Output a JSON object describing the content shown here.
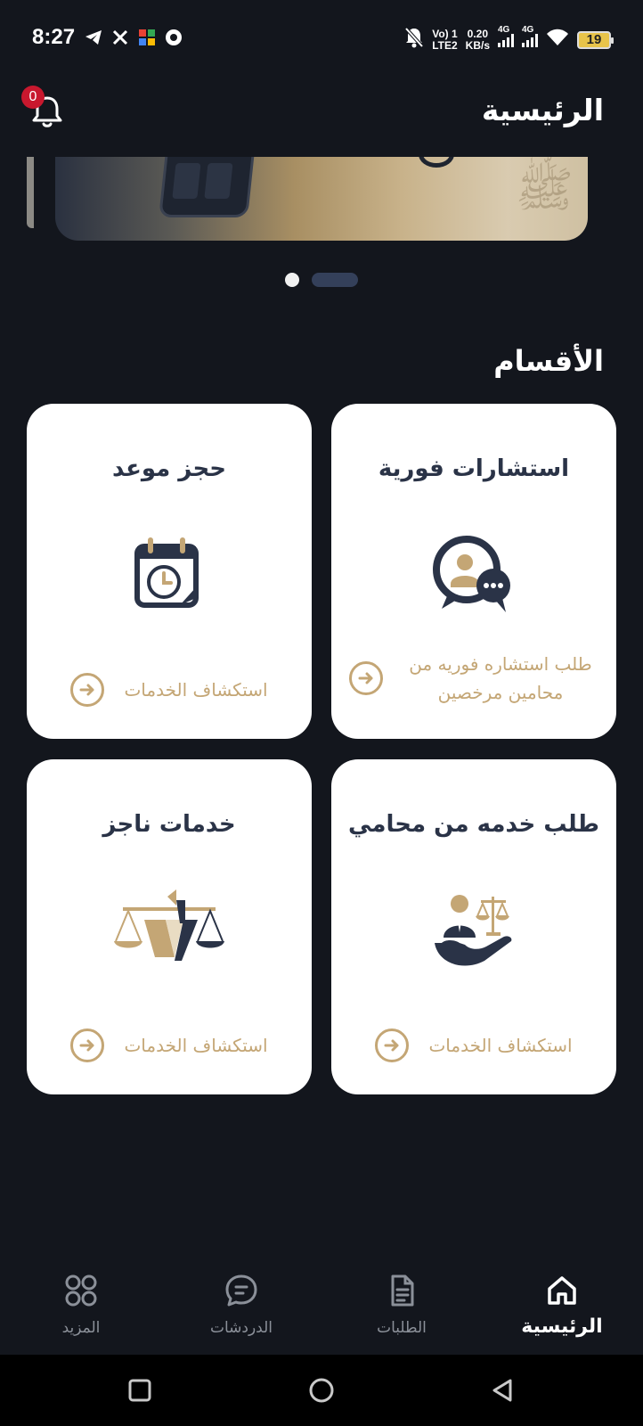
{
  "status_bar": {
    "time": "8:27",
    "network_line1": "Vo) 1",
    "network_line2": "LTE2",
    "speed_value": "0.20",
    "speed_unit": "KB/s",
    "sim1_label": "4G",
    "sim2_label": "4G",
    "battery": "19"
  },
  "header": {
    "title": "الرئيسية",
    "notification_count": "0"
  },
  "carousel": {
    "slide_count": 2,
    "active_index": 1
  },
  "sections": {
    "title": "الأقسام",
    "cards": [
      {
        "title": "استشارات فورية",
        "description": "طلب استشاره فوريه من محامين مرخصين",
        "icon": "consultation-chat-icon"
      },
      {
        "title": "حجز موعد",
        "description": "استكشاف الخدمات",
        "icon": "calendar-clock-icon"
      },
      {
        "title": "طلب خدمه من محامي",
        "description": "استكشاف الخدمات",
        "icon": "lawyer-scales-hand-icon"
      },
      {
        "title": "خدمات ناجز",
        "description": "استكشاف الخدمات",
        "icon": "najiz-scales-logo-icon"
      }
    ]
  },
  "bottom_nav": {
    "items": [
      {
        "label": "الرئيسية",
        "icon": "home-icon",
        "active": true
      },
      {
        "label": "الطلبات",
        "icon": "document-icon",
        "active": false
      },
      {
        "label": "الدردشات",
        "icon": "chat-icon",
        "active": false
      },
      {
        "label": "المزيد",
        "icon": "grid-icon",
        "active": false
      }
    ]
  },
  "colors": {
    "background": "#13161d",
    "card": "#ffffff",
    "navy": "#2a3347",
    "gold": "#c4a675",
    "badge": "#c8182e"
  }
}
